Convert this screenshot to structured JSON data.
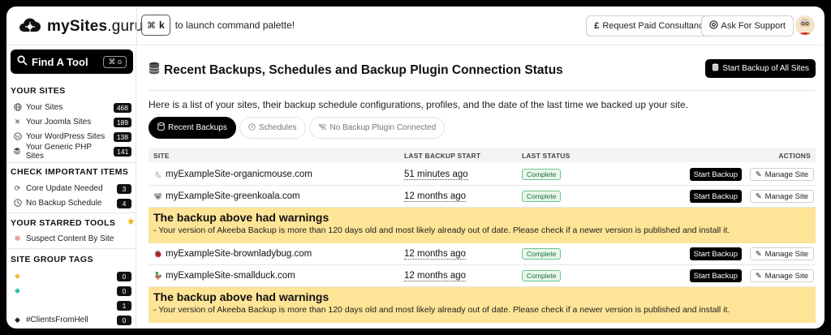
{
  "brand": {
    "name_bold": "mySites",
    "name_light": ".guru"
  },
  "command_palette": {
    "key_symbol": "⌘",
    "key_letter": "k",
    "hint": "to launch command palette!"
  },
  "header_buttons": {
    "consultancy": "Request Paid Consultancy",
    "support": "Ask For Support"
  },
  "sidebar": {
    "find_tool": {
      "label": "Find A Tool",
      "shortcut": "⌘ o"
    },
    "your_sites": {
      "heading": "YOUR SITES",
      "items": [
        {
          "label": "Your Sites",
          "count": "468",
          "icon": "globe-icon"
        },
        {
          "label": "Your Joomla Sites",
          "count": "189",
          "icon": "joomla-icon"
        },
        {
          "label": "Your WordPress Sites",
          "count": "138",
          "icon": "wordpress-icon"
        },
        {
          "label": "Your Generic PHP Sites",
          "count": "141",
          "icon": "php-icon"
        }
      ]
    },
    "check_items": {
      "heading": "CHECK IMPORTANT ITEMS",
      "items": [
        {
          "label": "Core Update Needed",
          "count": "3",
          "icon": "refresh-icon"
        },
        {
          "label": "No Backup Schedule",
          "count": "4",
          "icon": "clock-icon"
        }
      ]
    },
    "starred": {
      "heading": "YOUR STARRED TOOLS",
      "items": [
        {
          "label": "Suspect Content By Site",
          "icon": "bug-icon"
        }
      ]
    },
    "tags": {
      "heading": "SITE GROUP TAGS",
      "items": [
        {
          "label": "",
          "count": "0",
          "color": "#f5b942"
        },
        {
          "label": "",
          "count": "0",
          "color": "#2bbfa4"
        },
        {
          "label": "",
          "count": "1",
          "color": ""
        },
        {
          "label": "#ClientsFromHell",
          "count": "0",
          "color": "#222222"
        }
      ]
    }
  },
  "main": {
    "title": "Recent Backups, Schedules and Backup Plugin Connection Status",
    "start_all": "Start Backup of All Sites",
    "description": "Here is a list of your sites, their backup schedule configurations, profiles, and the date of the last time we backed up your site.",
    "tabs": [
      {
        "label": "Recent Backups"
      },
      {
        "label": "Schedules"
      },
      {
        "label": "No Backup Plugin Connected"
      }
    ],
    "table": {
      "headers": {
        "site": "SITE",
        "last_start": "LAST BACKUP START",
        "last_status": "LAST STATUS",
        "actions": "ACTIONS"
      },
      "rows": [
        {
          "site": "myExampleSite-organicmouse.com",
          "time": "51 minutes ago",
          "status": "Complete",
          "fav": "🐁"
        },
        {
          "site": "myExampleSite-greenkoala.com",
          "time": "12 months ago",
          "status": "Complete",
          "fav": "🐨"
        },
        {
          "site": "myExampleSite-brownladybug.com",
          "time": "12 months ago",
          "status": "Complete",
          "fav": "🐞"
        },
        {
          "site": "myExampleSite-smallduck.com",
          "time": "12 months ago",
          "status": "Complete",
          "fav": "🦆"
        }
      ],
      "start_label": "Start Backup",
      "manage_label": "Manage Site"
    },
    "warning": {
      "title": "The backup above had warnings",
      "message": "- Your version of Akeeba Backup is more than 120 days old and most likely already out of date. Please check if a newer version is published and install it."
    }
  }
}
